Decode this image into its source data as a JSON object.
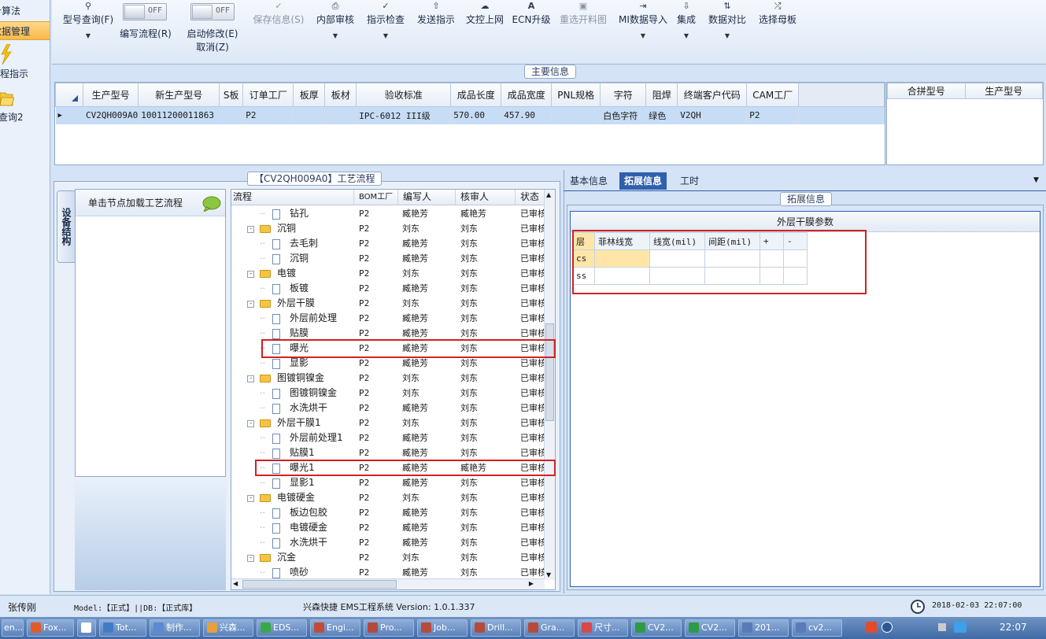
{
  "nav": {
    "items": [
      {
        "label": "计算法"
      },
      {
        "label": "数据管理"
      },
      {
        "label": "工程指示"
      },
      {
        "label": "查询2"
      }
    ]
  },
  "toolbar": {
    "buttons": [
      {
        "label": "型号查询(F)",
        "icon": "search-icon"
      },
      {
        "label": "编写流程(R)"
      },
      {
        "label": "启动修改(E)",
        "sub": "取消(Z)"
      },
      {
        "label": "保存信息(S)",
        "icon": "check-icon"
      },
      {
        "label": "内部审核",
        "icon": "print-icon"
      },
      {
        "label": "指示检查",
        "icon": "check-icon"
      },
      {
        "label": "发送指示",
        "icon": "upload-icon"
      },
      {
        "label": "文控上网",
        "icon": "cloud-icon"
      },
      {
        "label": "ECN升级",
        "icon": "a-icon"
      },
      {
        "label": "重选开料图",
        "icon": "image-icon"
      },
      {
        "label": "MI数据导入",
        "icon": "import-icon"
      },
      {
        "label": "集成",
        "icon": "download-icon"
      },
      {
        "label": "数据对比",
        "icon": "compare-icon"
      },
      {
        "label": "选择母板",
        "icon": "shuffle-icon"
      }
    ],
    "toggle_off": "OFF"
  },
  "main_info": {
    "title": "主要信息",
    "columns": [
      "生产型号",
      "新生产型号",
      "S板",
      "订单工厂",
      "板厚",
      "板材",
      "验收标准",
      "成品长度",
      "成品宽度",
      "PNL规格",
      "字符",
      "阻焊",
      "终端客户代码",
      "CAM工厂"
    ],
    "rows": [
      [
        "CV2QH009A0",
        "10011200011863",
        "",
        "P2",
        "",
        "",
        "IPC-6012 III级",
        "570.00",
        "457.90",
        "",
        "白色字符",
        "绿色",
        "V2QH",
        "P2"
      ]
    ],
    "side_columns": [
      "合拼型号",
      "生产型号"
    ]
  },
  "process": {
    "title": "【CV2QH009A0】工艺流程",
    "side_tab": "设备结构",
    "side_hint": "单击节点加载工艺流程",
    "columns": [
      "流程",
      "BOM工厂",
      "编写人",
      "核审人",
      "状态"
    ],
    "rows": [
      {
        "name": "钻孔",
        "level": 2,
        "type": "doc",
        "bom": "P2",
        "writer": "臧艳芳",
        "checker": "臧艳芳",
        "status": "已审核"
      },
      {
        "name": "沉铜",
        "level": 1,
        "type": "folder",
        "bom": "P2",
        "writer": "刘东",
        "checker": "刘东",
        "status": "已审核"
      },
      {
        "name": "去毛刺",
        "level": 2,
        "type": "doc",
        "bom": "P2",
        "writer": "臧艳芳",
        "checker": "刘东",
        "status": "已审核"
      },
      {
        "name": "沉铜",
        "level": 2,
        "type": "doc",
        "bom": "P2",
        "writer": "臧艳芳",
        "checker": "刘东",
        "status": "已审核"
      },
      {
        "name": "电镀",
        "level": 1,
        "type": "folder",
        "bom": "P2",
        "writer": "刘东",
        "checker": "刘东",
        "status": "已审核"
      },
      {
        "name": "板镀",
        "level": 2,
        "type": "doc",
        "bom": "P2",
        "writer": "臧艳芳",
        "checker": "刘东",
        "status": "已审核"
      },
      {
        "name": "外层干膜",
        "level": 1,
        "type": "folder",
        "bom": "P2",
        "writer": "刘东",
        "checker": "刘东",
        "status": "已审核"
      },
      {
        "name": "外层前处理",
        "level": 2,
        "type": "doc",
        "bom": "P2",
        "writer": "臧艳芳",
        "checker": "刘东",
        "status": "已审核"
      },
      {
        "name": "贴膜",
        "level": 2,
        "type": "doc",
        "bom": "P2",
        "writer": "臧艳芳",
        "checker": "刘东",
        "status": "已审核"
      },
      {
        "name": "曝光",
        "level": 2,
        "type": "doc",
        "bom": "P2",
        "writer": "臧艳芳",
        "checker": "刘东",
        "status": "已审核"
      },
      {
        "name": "显影",
        "level": 2,
        "type": "doc",
        "bom": "P2",
        "writer": "臧艳芳",
        "checker": "刘东",
        "status": "已审核"
      },
      {
        "name": "图镀铜镍金",
        "level": 1,
        "type": "folder",
        "bom": "P2",
        "writer": "刘东",
        "checker": "刘东",
        "status": "已审核"
      },
      {
        "name": "图镀铜镍金",
        "level": 2,
        "type": "doc",
        "bom": "P2",
        "writer": "刘东",
        "checker": "刘东",
        "status": "已审核"
      },
      {
        "name": "水洗烘干",
        "level": 2,
        "type": "doc",
        "bom": "P2",
        "writer": "臧艳芳",
        "checker": "刘东",
        "status": "已审核"
      },
      {
        "name": "外层干膜1",
        "level": 1,
        "type": "folder",
        "bom": "P2",
        "writer": "刘东",
        "checker": "刘东",
        "status": "已审核"
      },
      {
        "name": "外层前处理1",
        "level": 2,
        "type": "doc",
        "bom": "P2",
        "writer": "臧艳芳",
        "checker": "刘东",
        "status": "已审核"
      },
      {
        "name": "贴膜1",
        "level": 2,
        "type": "doc",
        "bom": "P2",
        "writer": "臧艳芳",
        "checker": "刘东",
        "status": "已审核"
      },
      {
        "name": "曝光1",
        "level": 2,
        "type": "doc",
        "bom": "P2",
        "writer": "臧艳芳",
        "checker": "臧艳芳",
        "status": "已审核"
      },
      {
        "name": "显影1",
        "level": 2,
        "type": "doc",
        "bom": "P2",
        "writer": "臧艳芳",
        "checker": "刘东",
        "status": "已审核"
      },
      {
        "name": "电镀硬金",
        "level": 1,
        "type": "folder",
        "bom": "P2",
        "writer": "刘东",
        "checker": "刘东",
        "status": "已审核"
      },
      {
        "name": "板边包胶",
        "level": 2,
        "type": "doc",
        "bom": "P2",
        "writer": "臧艳芳",
        "checker": "刘东",
        "status": "已审核"
      },
      {
        "name": "电镀硬金",
        "level": 2,
        "type": "doc",
        "bom": "P2",
        "writer": "臧艳芳",
        "checker": "刘东",
        "status": "已审核"
      },
      {
        "name": "水洗烘干",
        "level": 2,
        "type": "doc",
        "bom": "P2",
        "writer": "臧艳芳",
        "checker": "刘东",
        "status": "已审核"
      },
      {
        "name": "沉金",
        "level": 1,
        "type": "folder",
        "bom": "P2",
        "writer": "刘东",
        "checker": "刘东",
        "status": "已审核"
      },
      {
        "name": "喷砂",
        "level": 2,
        "type": "doc",
        "bom": "P2",
        "writer": "臧艳芳",
        "checker": "刘东",
        "status": "已审核"
      }
    ]
  },
  "tabs": [
    "基本信息",
    "拓展信息",
    "工时"
  ],
  "ext": {
    "group_title": "拓展信息",
    "params_title": "外层干膜参数",
    "columns": [
      "层",
      "菲林线宽",
      "线宽(mil)",
      "间距(mil)",
      "+",
      "-"
    ],
    "rows": [
      [
        "cs",
        "",
        "",
        "",
        "",
        ""
      ],
      [
        "ss",
        "",
        "",
        "",
        "",
        ""
      ]
    ]
  },
  "status": {
    "user": "张传刚",
    "model": "Model:【正式】||DB:【正式库】",
    "system": "兴森快捷 EMS工程系统 Version: 1.0.1.337",
    "datetime": "2018-02-03 22:07:00"
  },
  "taskbar": {
    "tasks": [
      "en...",
      "Fox...",
      "",
      "Tot...",
      "制作...",
      "兴森...",
      "EDS...",
      "Engi...",
      "Pro...",
      "Job...",
      "Drill...",
      "Gra...",
      "尺寸...",
      "CV2...",
      "CV2...",
      "201...",
      "cv2..."
    ],
    "clock": "22:07"
  },
  "colors": {
    "accent": "#2f5fae",
    "highlight": "#d42020",
    "selected_row": "#c7dcf5"
  }
}
